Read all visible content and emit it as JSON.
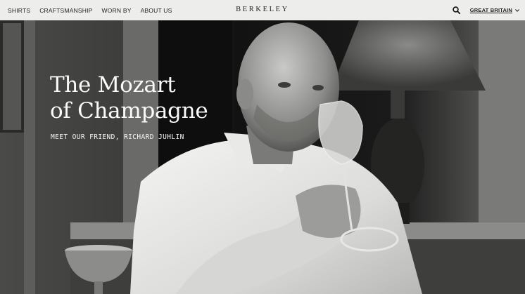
{
  "nav": {
    "links": [
      {
        "label": "SHIRTS"
      },
      {
        "label": "CRAFTSMANSHIP"
      },
      {
        "label": "WORN BY"
      },
      {
        "label": "ABOUT US"
      }
    ],
    "brand": "BERKELEY",
    "search_icon": "search-icon",
    "region_label": "GREAT BRITAIN",
    "region_icon": "chevron-down-icon"
  },
  "hero": {
    "title_line1": "The Mozart",
    "title_line2": "of Champagne",
    "subtitle": "MEET OUR FRIEND, RICHARD JUHLIN",
    "image": "black-and-white portrait photo"
  },
  "colors": {
    "nav_bg": "#ededeb",
    "text_dark": "#1f1f1f",
    "hero_text": "#fafafa"
  }
}
